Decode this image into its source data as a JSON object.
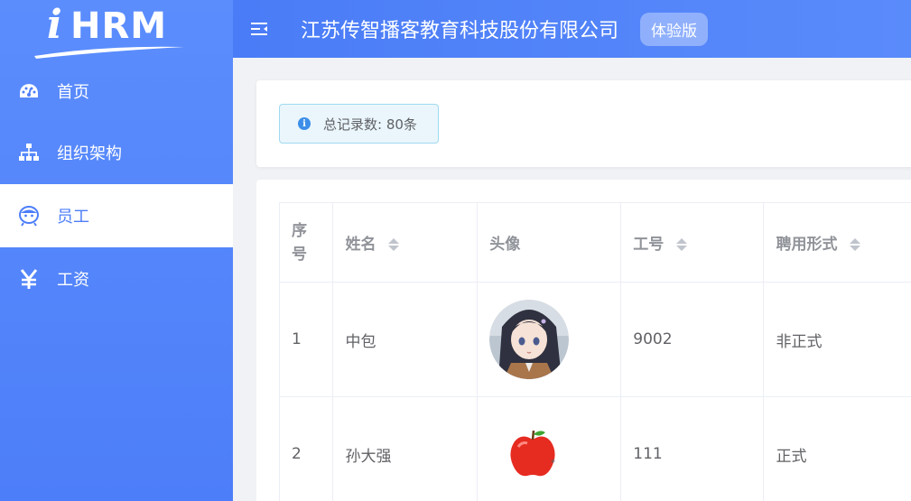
{
  "logo": {
    "text": "HRM",
    "i_letter": "i"
  },
  "sidebar": {
    "items": [
      {
        "label": "首页",
        "icon": "dashboard-icon",
        "active": false
      },
      {
        "label": "组织架构",
        "icon": "org-chart-icon",
        "active": false
      },
      {
        "label": "员工",
        "icon": "employee-face-icon",
        "active": true
      },
      {
        "label": "工资",
        "icon": "yen-icon",
        "active": false
      }
    ]
  },
  "header": {
    "company_name": "江苏传智播客教育科技股份有限公司",
    "badge": "体验版"
  },
  "info": {
    "alert_text": "总记录数: 80条"
  },
  "table": {
    "headers": {
      "index": [
        "序",
        "号"
      ],
      "name": "姓名",
      "avatar": "头像",
      "work_no": "工号",
      "employment_form": "聘用形式"
    },
    "rows": [
      {
        "index": "1",
        "name": "中包",
        "avatar": "anime-girl-avatar",
        "work_no": "9002",
        "employment_form": "非正式"
      },
      {
        "index": "2",
        "name": "孙大强",
        "avatar": "apple-avatar",
        "work_no": "111",
        "employment_form": "正式"
      }
    ]
  },
  "colors": {
    "sidebar": "#4d7ef9",
    "header": "#4a7cf7",
    "active_text": "#4d7ef9",
    "alert_bg": "#eaf6fc",
    "alert_border": "#9fd9f1"
  }
}
